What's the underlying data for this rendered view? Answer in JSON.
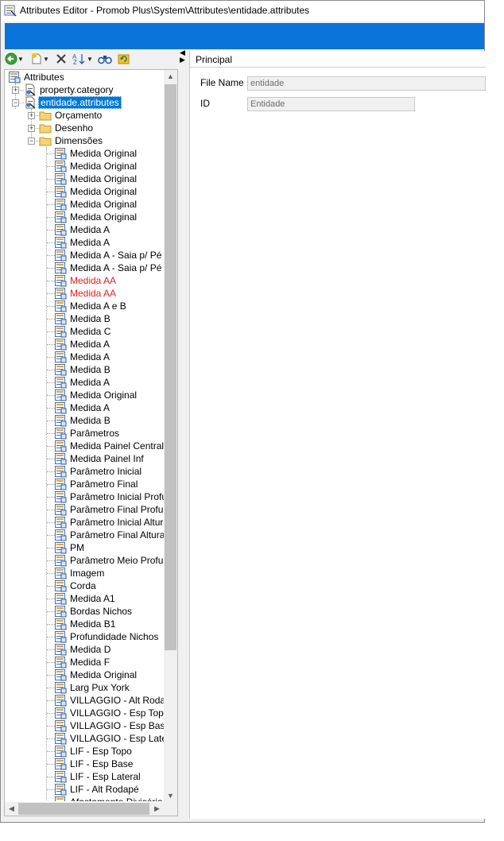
{
  "window": {
    "title": "Attributes Editor - Promob Plus\\System\\Attributes\\entidade.attributes",
    "accent_color": "#0a74da"
  },
  "toolbar": {
    "icons": [
      "back-arrow-icon",
      "new-item-icon",
      "delete-icon",
      "sort-icon",
      "find-icon",
      "refresh-icon"
    ]
  },
  "tree": {
    "root": "Attributes",
    "files": [
      {
        "label": "property.category"
      },
      {
        "label": "entidade.attributes"
      }
    ],
    "folders": [
      "Orçamento",
      "Desenho",
      "Dimensões"
    ],
    "items": [
      {
        "label": "Medida Original"
      },
      {
        "label": "Medida Original"
      },
      {
        "label": "Medida Original"
      },
      {
        "label": "Medida Original"
      },
      {
        "label": "Medida Original"
      },
      {
        "label": "Medida Original"
      },
      {
        "label": "Medida A"
      },
      {
        "label": "Medida A"
      },
      {
        "label": "Medida A - Saia p/ Pé Pa"
      },
      {
        "label": "Medida A - Saia p/ Pé Mó"
      },
      {
        "label": "Medida AA",
        "color": "#e52020"
      },
      {
        "label": "Medida AA",
        "color": "#e52020"
      },
      {
        "label": "Medida A e B"
      },
      {
        "label": "Medida B"
      },
      {
        "label": "Medida C"
      },
      {
        "label": "Medida A"
      },
      {
        "label": "Medida A"
      },
      {
        "label": "Medida B"
      },
      {
        "label": "Medida A"
      },
      {
        "label": "Medida Original"
      },
      {
        "label": "Medida A"
      },
      {
        "label": "Medida B"
      },
      {
        "label": "Parâmetros"
      },
      {
        "label": "Medida Painel Central"
      },
      {
        "label": "Medida Painel Inf"
      },
      {
        "label": "Parâmetro Inicial"
      },
      {
        "label": "Parâmetro Final"
      },
      {
        "label": "Parâmetro Inicial Profun"
      },
      {
        "label": "Parâmetro Final Profund"
      },
      {
        "label": "Parâmetro Inicial Altura"
      },
      {
        "label": "Parâmetro Final Altura"
      },
      {
        "label": "PM"
      },
      {
        "label": "Parâmetro Meio Profund"
      },
      {
        "label": "Imagem"
      },
      {
        "label": "Corda"
      },
      {
        "label": "Medida A1"
      },
      {
        "label": "Bordas Nichos"
      },
      {
        "label": "Medida B1"
      },
      {
        "label": "Profundidade Nichos"
      },
      {
        "label": "Medida D"
      },
      {
        "label": "Medida F"
      },
      {
        "label": "Medida Original"
      },
      {
        "label": "Larg Pux York"
      },
      {
        "label": "VILLAGGIO - Alt Rodapé"
      },
      {
        "label": "VILLAGGIO - Esp Topo"
      },
      {
        "label": "VILLAGGIO - Esp Base"
      },
      {
        "label": "VILLAGGIO - Esp Latera"
      },
      {
        "label": "LIF - Esp Topo"
      },
      {
        "label": "LIF - Esp Base"
      },
      {
        "label": "LIF - Esp Lateral"
      },
      {
        "label": "LIF - Alt Rodapé"
      },
      {
        "label": "Afastamento Divisória"
      }
    ]
  },
  "properties": {
    "section_title": "Principal",
    "file_name_label": "File Name",
    "file_name_value": "entidade",
    "id_label": "ID",
    "id_value": "Entidade"
  }
}
